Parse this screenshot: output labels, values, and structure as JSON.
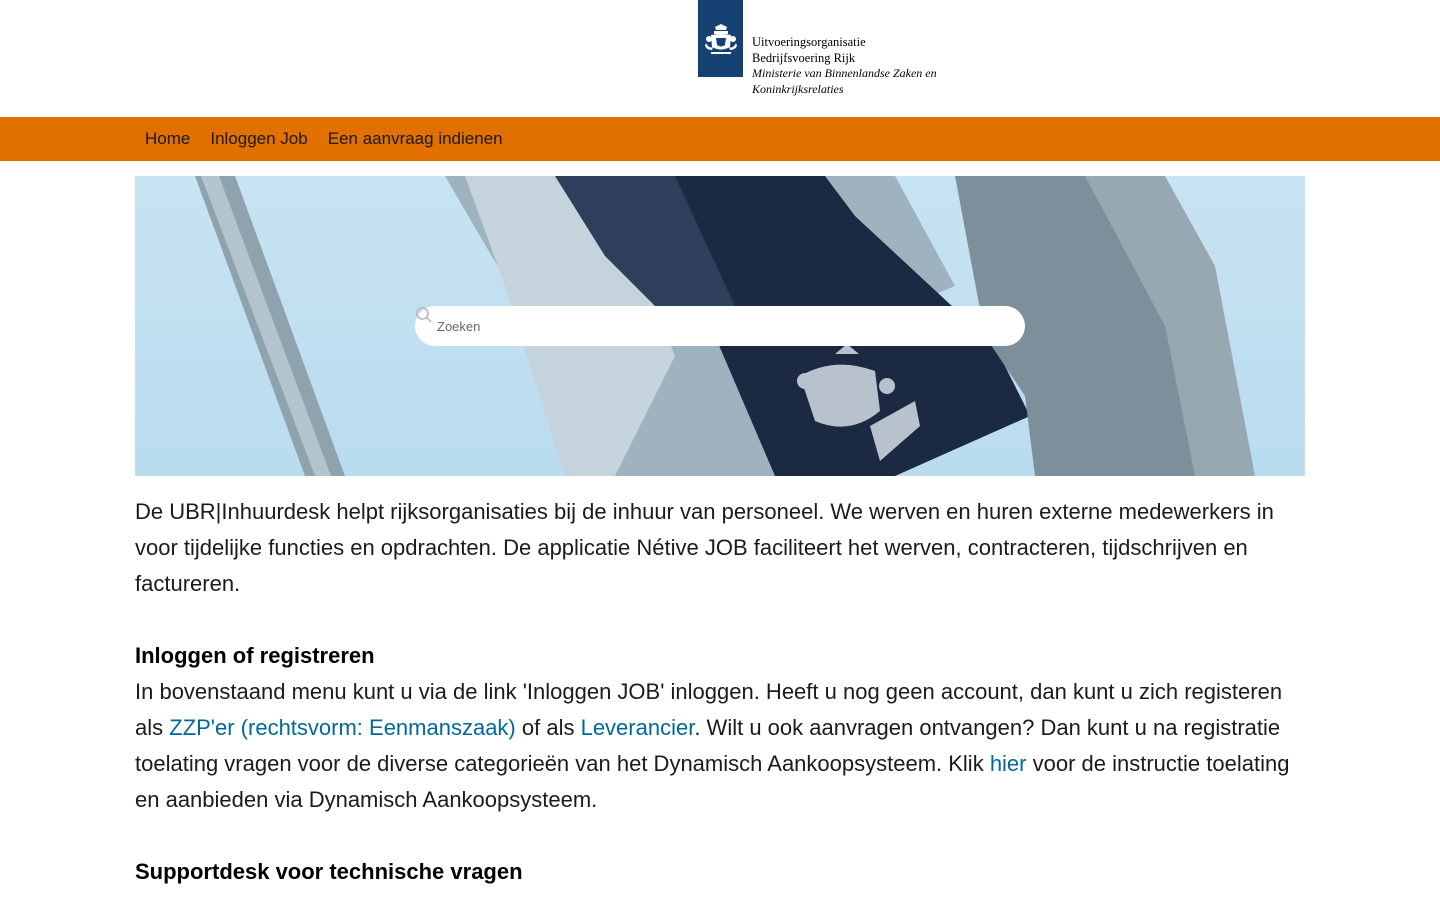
{
  "header": {
    "logo_line1": "Uitvoeringsorganisatie",
    "logo_line2": "Bedrijfsvoering Rijk",
    "logo_line3": "Ministerie van Binnenlandse Zaken en",
    "logo_line4": "Koninkrijksrelaties"
  },
  "nav": {
    "items": [
      {
        "label": "Home"
      },
      {
        "label": "Inloggen Job"
      },
      {
        "label": "Een aanvraag indienen"
      }
    ]
  },
  "search": {
    "placeholder": "Zoeken"
  },
  "content": {
    "intro": "De UBR|Inhuurdesk helpt rijksorganisaties bij de inhuur van personeel. We werven en huren externe medewerkers in voor tijdelijke functies en opdrachten. De applicatie Nétive JOB faciliteert het werven, contracteren, tijdschrijven en factureren.",
    "section1_title": "Inloggen of registreren",
    "section1_text_a": "In bovenstaand menu kunt u via de link 'Inloggen JOB' inloggen. Heeft u nog geen account, dan kunt u zich registeren als ",
    "section1_link_zzp": "ZZP'er (rechtsvorm: Eenmanszaak)",
    "section1_text_b": " of als ",
    "section1_link_leverancier": "Leverancier",
    "section1_text_c": ". Wilt u ook aanvragen ontvangen? Dan kunt u na registratie toelating vragen voor de diverse categorieën van het Dynamisch Aankoopsysteem. Klik ",
    "section1_link_hier": "hier",
    "section1_text_d": " voor de instructie toelating en aanbieden via Dynamisch Aankoopsysteem.",
    "section2_title": "Supportdesk voor technische vragen"
  },
  "colors": {
    "nav_orange": "#e17000",
    "logo_blue": "#154273",
    "link_blue": "#01689b"
  }
}
